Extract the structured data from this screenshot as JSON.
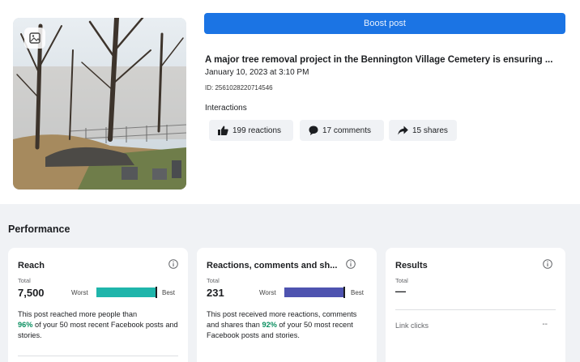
{
  "post": {
    "boost_label": "Boost post",
    "title": "A major tree removal project in the Bennington Village Cemetery is ensuring ...",
    "date": "January 10, 2023 at 3:10 PM",
    "id_text": "ID: 2561028220714546",
    "interactions_label": "Interactions",
    "reactions": "199 reactions",
    "comments": "17 comments",
    "shares": "15 shares"
  },
  "performance": {
    "title": "Performance",
    "reach": {
      "title": "Reach",
      "total_label": "Total",
      "total": "7,500",
      "worst": "Worst",
      "best": "Best",
      "bar_position": 0.98,
      "bar_color": "#1fb5ab",
      "desc_before": "This post reached more people than",
      "desc_percent": "96%",
      "desc_after": "of your 50 most recent Facebook posts and stories."
    },
    "rcs": {
      "title": "Reactions, comments and sh...",
      "total_label": "Total",
      "total": "231",
      "worst": "Worst",
      "best": "Best",
      "bar_position": 0.98,
      "bar_color": "#4e53b0",
      "desc_before": "This post received more reactions, comments and shares than",
      "desc_percent": "92%",
      "desc_after": "of your 50 most recent Facebook posts and stories."
    },
    "results": {
      "title": "Results",
      "total_label": "Total",
      "total": "—",
      "link_clicks_label": "Link clicks",
      "link_clicks_value": "--"
    }
  },
  "colors": {
    "accent": "#1b74e4",
    "highlight": "#0a8f60"
  }
}
